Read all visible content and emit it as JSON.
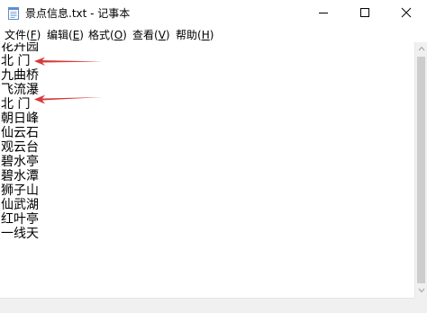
{
  "window": {
    "title": "景点信息.txt - 记事本",
    "app_icon": "notepad-icon",
    "controls": [
      "minimize-icon",
      "maximize-icon",
      "close-icon"
    ]
  },
  "menu": [
    {
      "label": "文件(",
      "key": "F",
      "end": ")"
    },
    {
      "label": "编辑(",
      "key": "E",
      "end": ")"
    },
    {
      "label": "格式(",
      "key": "O",
      "end": ")"
    },
    {
      "label": "查看(",
      "key": "V",
      "end": ")"
    },
    {
      "label": "帮助(",
      "key": "H",
      "end": ")"
    }
  ],
  "editor": {
    "lines": [
      "花卉园",
      "北 门",
      "九曲桥",
      "飞流瀑",
      "北 门",
      "朝日峰",
      "仙云石",
      "观云台",
      "碧水亭",
      "碧水潭",
      "狮子山",
      "仙武湖",
      "红叶亭",
      "一线天"
    ]
  },
  "annotations": {
    "arrow_color": "#d63a3a",
    "arrow_icon": "red-arrow-icon"
  }
}
